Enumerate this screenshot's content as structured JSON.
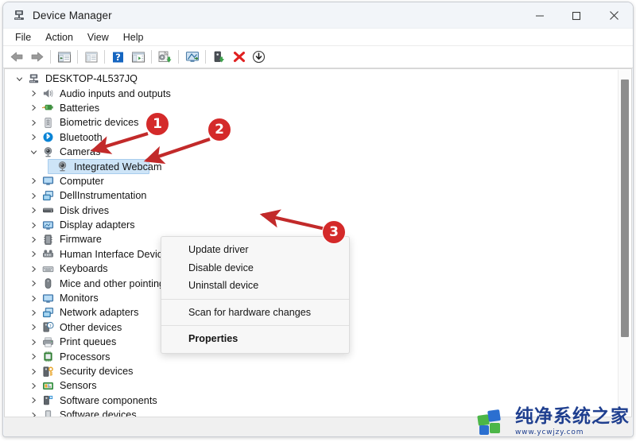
{
  "window": {
    "title": "Device Manager",
    "title_icon": "device-manager-icon",
    "controls": {
      "minimize": "–",
      "maximize": "☐",
      "close": "✕"
    }
  },
  "menubar": {
    "items": [
      {
        "label": "File"
      },
      {
        "label": "Action"
      },
      {
        "label": "View"
      },
      {
        "label": "Help"
      }
    ]
  },
  "toolbar": {
    "buttons": [
      {
        "name": "back-icon"
      },
      {
        "name": "forward-icon"
      },
      {
        "name": "show-hide-console-tree-icon"
      },
      {
        "name": "properties-icon"
      },
      {
        "name": "help-icon"
      },
      {
        "name": "show-hide-action-pane-icon"
      },
      {
        "name": "update-driver-icon"
      },
      {
        "name": "scan-for-hardware-changes-icon"
      },
      {
        "name": "enable-device-icon"
      },
      {
        "name": "uninstall-device-icon"
      },
      {
        "name": "download-icon"
      }
    ]
  },
  "tree": {
    "items": [
      {
        "label": "DESKTOP-4L537JQ",
        "icon": "computer-node-icon",
        "depth": 0,
        "state": "expanded",
        "selected": false
      },
      {
        "label": "Audio inputs and outputs",
        "icon": "speaker-icon",
        "depth": 1,
        "state": "collapsed",
        "selected": false
      },
      {
        "label": "Batteries",
        "icon": "battery-icon",
        "depth": 1,
        "state": "collapsed",
        "selected": false
      },
      {
        "label": "Biometric devices",
        "icon": "fingerprint-icon",
        "depth": 1,
        "state": "collapsed",
        "selected": false
      },
      {
        "label": "Bluetooth",
        "icon": "bluetooth-icon",
        "depth": 1,
        "state": "collapsed",
        "selected": false
      },
      {
        "label": "Cameras",
        "icon": "camera-icon",
        "depth": 1,
        "state": "expanded",
        "selected": false
      },
      {
        "label": "Integrated Webcam",
        "icon": "camera-icon",
        "depth": 2,
        "state": "leaf",
        "selected": true
      },
      {
        "label": "Computer",
        "icon": "monitor-icon",
        "depth": 1,
        "state": "collapsed",
        "selected": false
      },
      {
        "label": "DellInstrumentation",
        "icon": "network-device-icon",
        "depth": 1,
        "state": "collapsed",
        "selected": false
      },
      {
        "label": "Disk drives",
        "icon": "disk-drive-icon",
        "depth": 1,
        "state": "collapsed",
        "selected": false
      },
      {
        "label": "Display adapters",
        "icon": "display-adapter-icon",
        "depth": 1,
        "state": "collapsed",
        "selected": false
      },
      {
        "label": "Firmware",
        "icon": "firmware-chip-icon",
        "depth": 1,
        "state": "collapsed",
        "selected": false
      },
      {
        "label": "Human Interface Device",
        "icon": "hid-icon",
        "depth": 1,
        "state": "collapsed",
        "selected": false
      },
      {
        "label": "Keyboards",
        "icon": "keyboard-icon",
        "depth": 1,
        "state": "collapsed",
        "selected": false
      },
      {
        "label": "Mice and other pointing devices",
        "icon": "mouse-icon",
        "depth": 1,
        "state": "collapsed",
        "selected": false
      },
      {
        "label": "Monitors",
        "icon": "monitor-icon",
        "depth": 1,
        "state": "collapsed",
        "selected": false
      },
      {
        "label": "Network adapters",
        "icon": "network-device-icon",
        "depth": 1,
        "state": "collapsed",
        "selected": false
      },
      {
        "label": "Other devices",
        "icon": "unknown-device-icon",
        "depth": 1,
        "state": "collapsed",
        "selected": false
      },
      {
        "label": "Print queues",
        "icon": "printer-icon",
        "depth": 1,
        "state": "collapsed",
        "selected": false
      },
      {
        "label": "Processors",
        "icon": "processor-icon",
        "depth": 1,
        "state": "collapsed",
        "selected": false
      },
      {
        "label": "Security devices",
        "icon": "security-device-icon",
        "depth": 1,
        "state": "collapsed",
        "selected": false
      },
      {
        "label": "Sensors",
        "icon": "sensor-icon",
        "depth": 1,
        "state": "collapsed",
        "selected": false
      },
      {
        "label": "Software components",
        "icon": "software-component-icon",
        "depth": 1,
        "state": "collapsed",
        "selected": false
      },
      {
        "label": "Software devices",
        "icon": "software-device-icon",
        "depth": 1,
        "state": "collapsed",
        "selected": false
      }
    ]
  },
  "context_menu": {
    "items": [
      {
        "label": "Update driver",
        "bold": false,
        "separator_after": false
      },
      {
        "label": "Disable device",
        "bold": false,
        "separator_after": false
      },
      {
        "label": "Uninstall device",
        "bold": false,
        "separator_after": true
      },
      {
        "label": "Scan for hardware changes",
        "bold": false,
        "separator_after": true
      },
      {
        "label": "Properties",
        "bold": true,
        "separator_after": false
      }
    ]
  },
  "annotations": {
    "color": "#d42a2a",
    "markers": [
      {
        "label": "1",
        "target": "Cameras"
      },
      {
        "label": "2",
        "target": "Integrated Webcam"
      },
      {
        "label": "3",
        "target": "Uninstall device"
      }
    ]
  },
  "watermark": {
    "title": "纯净系统之家",
    "url": "www.ycwjzy.com",
    "brand_color": "#1f3f8f",
    "logo_colors": [
      "#4cb648",
      "#2b6fd0"
    ]
  }
}
